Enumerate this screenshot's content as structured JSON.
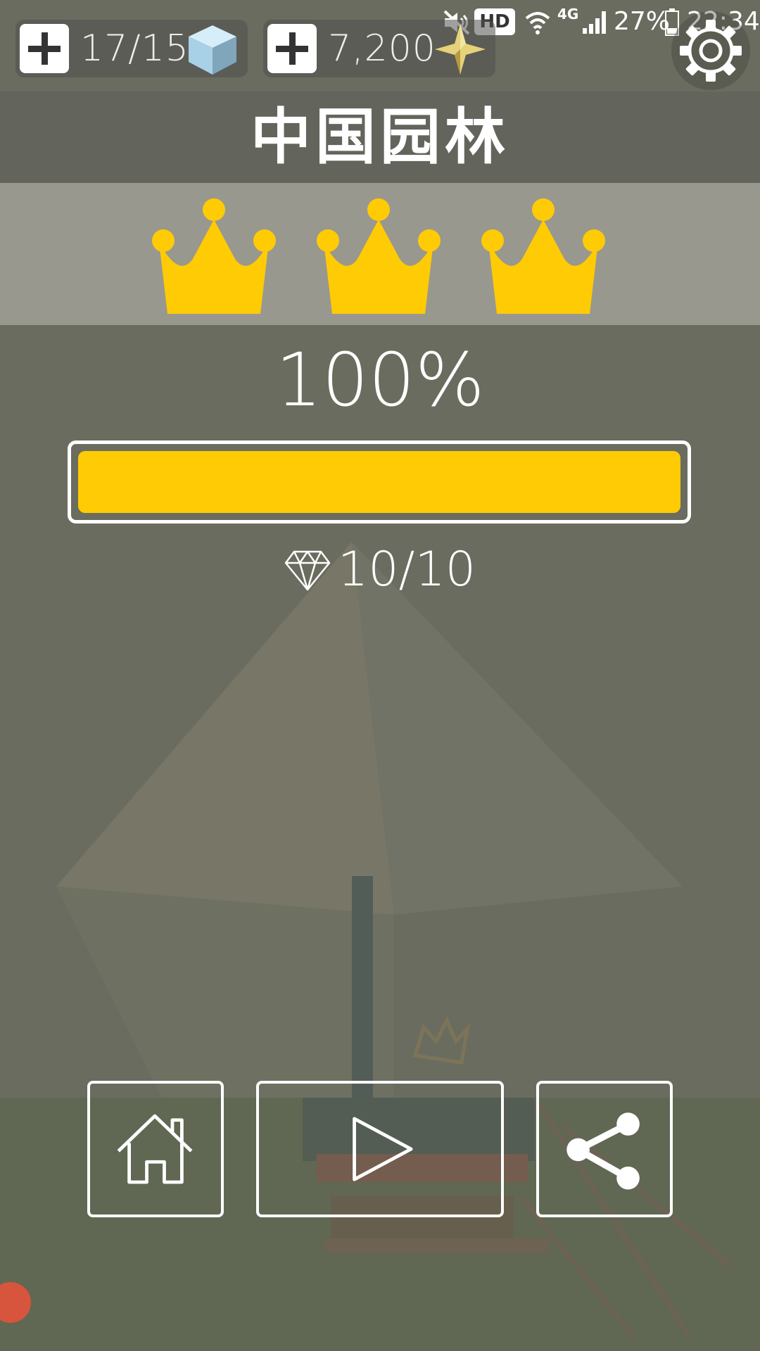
{
  "status_bar": {
    "hd_label": "HD",
    "network_label": "4G",
    "battery_text": "27%",
    "time": "22:34",
    "icons": [
      "mute-icon",
      "wifi-icon",
      "signal-icon",
      "battery-icon"
    ]
  },
  "resources": {
    "blocks": {
      "value": "17/15",
      "icon": "ice-cube-icon",
      "add_icon": "plus-icon"
    },
    "coins": {
      "value": "7,200",
      "icon": "gold-star-icon",
      "add_icon": "plus-icon"
    }
  },
  "settings": {
    "icon": "gear-icon"
  },
  "level": {
    "title": "中国园林",
    "crowns_earned": 3,
    "crowns_total": 3,
    "percent_text": "100%",
    "progress": 1.0,
    "gems_text": "10/10",
    "gem_icon": "diamond-icon"
  },
  "actions": [
    {
      "name": "home-button",
      "icon": "home-icon"
    },
    {
      "name": "play-button",
      "icon": "play-icon"
    },
    {
      "name": "share-button",
      "icon": "share-icon"
    }
  ],
  "colors": {
    "accent": "#ffcb05",
    "background": "#6f7160",
    "crown_band": "#b9bab2"
  }
}
